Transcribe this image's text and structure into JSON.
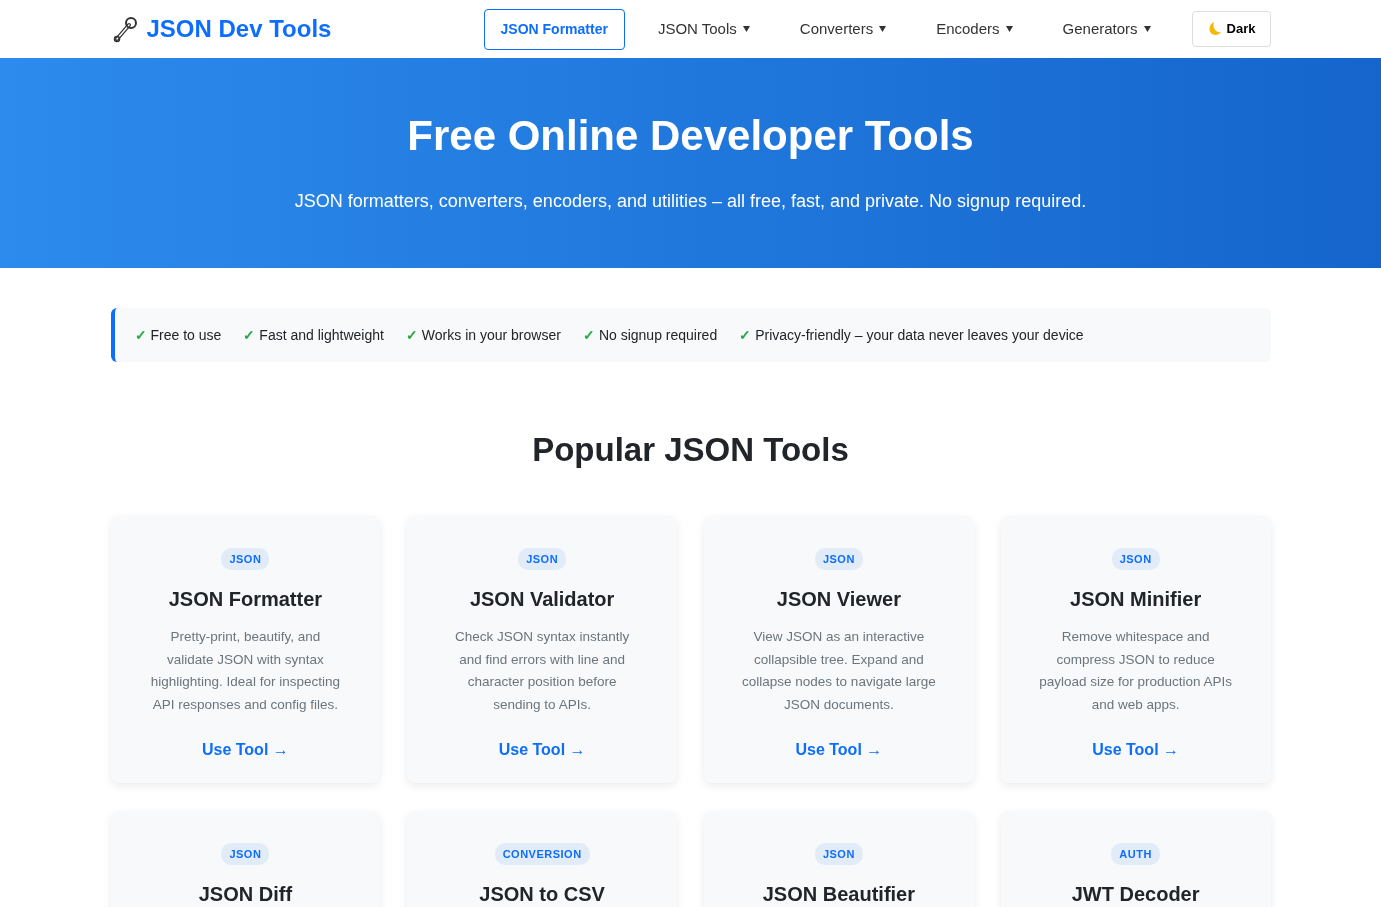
{
  "brand": {
    "name": "JSON Dev Tools"
  },
  "nav": [
    {
      "label": "JSON Formatter",
      "selected": true,
      "dropdown": false
    },
    {
      "label": "JSON Tools",
      "selected": false,
      "dropdown": true
    },
    {
      "label": "Converters",
      "selected": false,
      "dropdown": true
    },
    {
      "label": "Encoders",
      "selected": false,
      "dropdown": true
    },
    {
      "label": "Generators",
      "selected": false,
      "dropdown": true
    }
  ],
  "theme_button": {
    "label": "Dark"
  },
  "hero": {
    "title": "Free Online Developer Tools",
    "subtitle": "JSON formatters, converters, encoders, and utilities – all free, fast, and private. No signup required."
  },
  "features": [
    {
      "check": "✓",
      "text": "Free to use"
    },
    {
      "check": "✓",
      "text": "Fast and lightweight"
    },
    {
      "check": "✓",
      "text": "Works in your browser"
    },
    {
      "check": "✓",
      "text": "No signup required"
    },
    {
      "check": "✓",
      "text": "Privacy-friendly – your data never leaves your device"
    }
  ],
  "section_title": "Popular JSON Tools",
  "tools": [
    {
      "tag": "JSON",
      "title": "JSON Formatter",
      "description": "Pretty-print, beautify, and validate JSON with syntax highlighting. Ideal for inspecting API responses and config files.",
      "link": "Use Tool →"
    },
    {
      "tag": "JSON",
      "title": "JSON Validator",
      "description": "Check JSON syntax instantly and find errors with line and character position before sending to APIs.",
      "link": "Use Tool →"
    },
    {
      "tag": "JSON",
      "title": "JSON Viewer",
      "description": "View JSON as an interactive collapsible tree. Expand and collapse nodes to navigate large JSON documents.",
      "link": "Use Tool →"
    },
    {
      "tag": "JSON",
      "title": "JSON Minifier",
      "description": "Remove whitespace and compress JSON to reduce payload size for production APIs and web apps.",
      "link": "Use Tool →"
    },
    {
      "tag": "JSON",
      "title": "JSON Diff"
    },
    {
      "tag": "CONVERSION",
      "title": "JSON to CSV"
    },
    {
      "tag": "JSON",
      "title": "JSON Beautifier"
    },
    {
      "tag": "AUTH",
      "title": "JWT Decoder"
    }
  ]
}
